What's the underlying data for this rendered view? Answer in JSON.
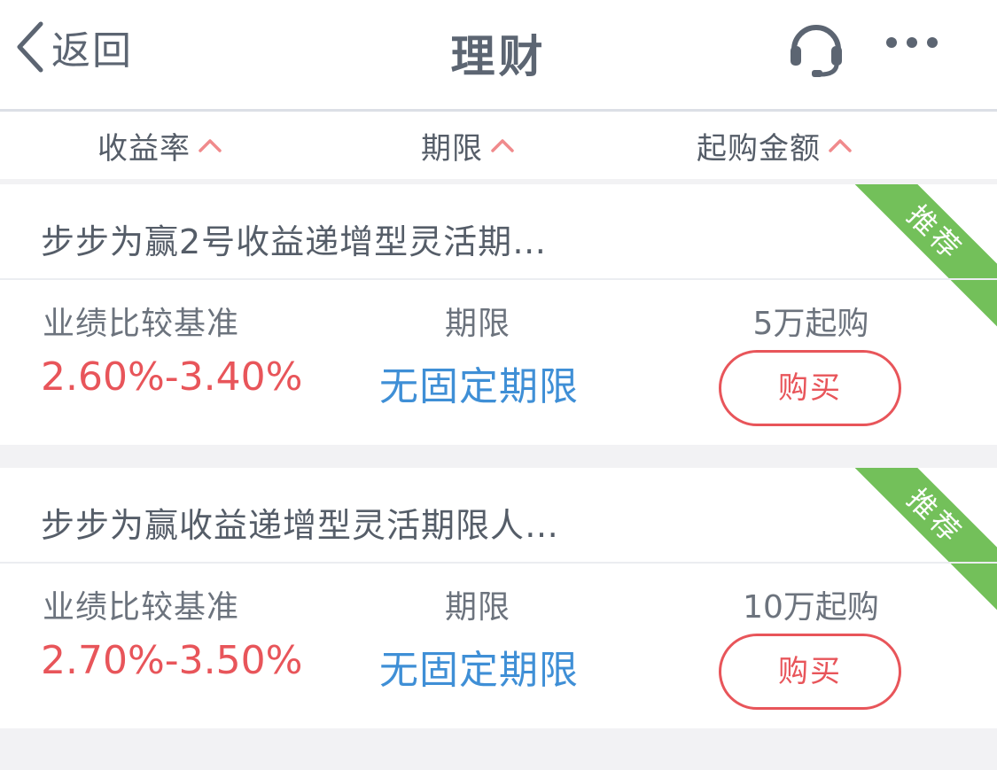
{
  "navbar": {
    "back_label": "返回",
    "title": "理财",
    "service_icon": "headset-icon",
    "more_icon": "more-dots-icon"
  },
  "sort": {
    "items": [
      {
        "label": "收益率",
        "icon": "sort-arrow-up-icon"
      },
      {
        "label": "期限",
        "icon": "sort-arrow-up-icon"
      },
      {
        "label": "起购金额",
        "icon": "sort-arrow-up-icon"
      }
    ]
  },
  "products": [
    {
      "title": "步步为赢2号收益递增型灵活期…",
      "badge": "推荐",
      "rate_label": "业绩比较基准",
      "rate": "2.60%-3.40%",
      "term_label": "期限",
      "term": "无固定期限",
      "min_amount": "5万起购",
      "buy_label": "购买"
    },
    {
      "title": "步步为赢收益递增型灵活期限人…",
      "badge": "推荐",
      "rate_label": "业绩比较基准",
      "rate": "2.70%-3.50%",
      "term_label": "期限",
      "term": "无固定期限",
      "min_amount": "10万起购",
      "buy_label": "购买"
    }
  ],
  "colors": {
    "accent_red": "#e8555a",
    "accent_blue": "#3f8fd6",
    "badge_green": "#73c05a",
    "text_gray": "#5c6572",
    "background": "#f2f2f4"
  }
}
